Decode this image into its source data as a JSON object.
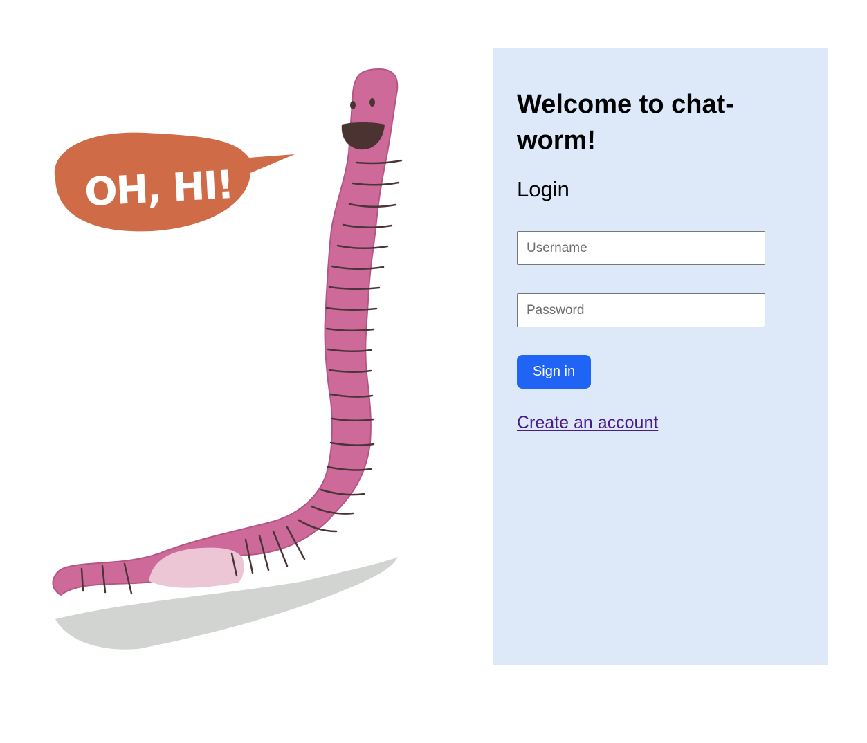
{
  "illustration": {
    "speech_text": "OH, HI!",
    "colors": {
      "worm": "#cd6a9a",
      "worm_band": "#4a3438",
      "worm_belly": "#ecc6d4",
      "speech_bubble": "#cf6b47",
      "speech_text": "#ffffff",
      "mouth": "#4a3330",
      "shadow": "#c9ccc9"
    }
  },
  "login": {
    "title": "Welcome to chat-worm!",
    "subtitle": "Login",
    "username_placeholder": "Username",
    "password_placeholder": "Password",
    "submit_label": "Sign in",
    "create_account_label": "Create an account"
  },
  "colors": {
    "panel_background": "#dde8f9",
    "button": "#1f64f5",
    "link": "#4a1c8a"
  }
}
